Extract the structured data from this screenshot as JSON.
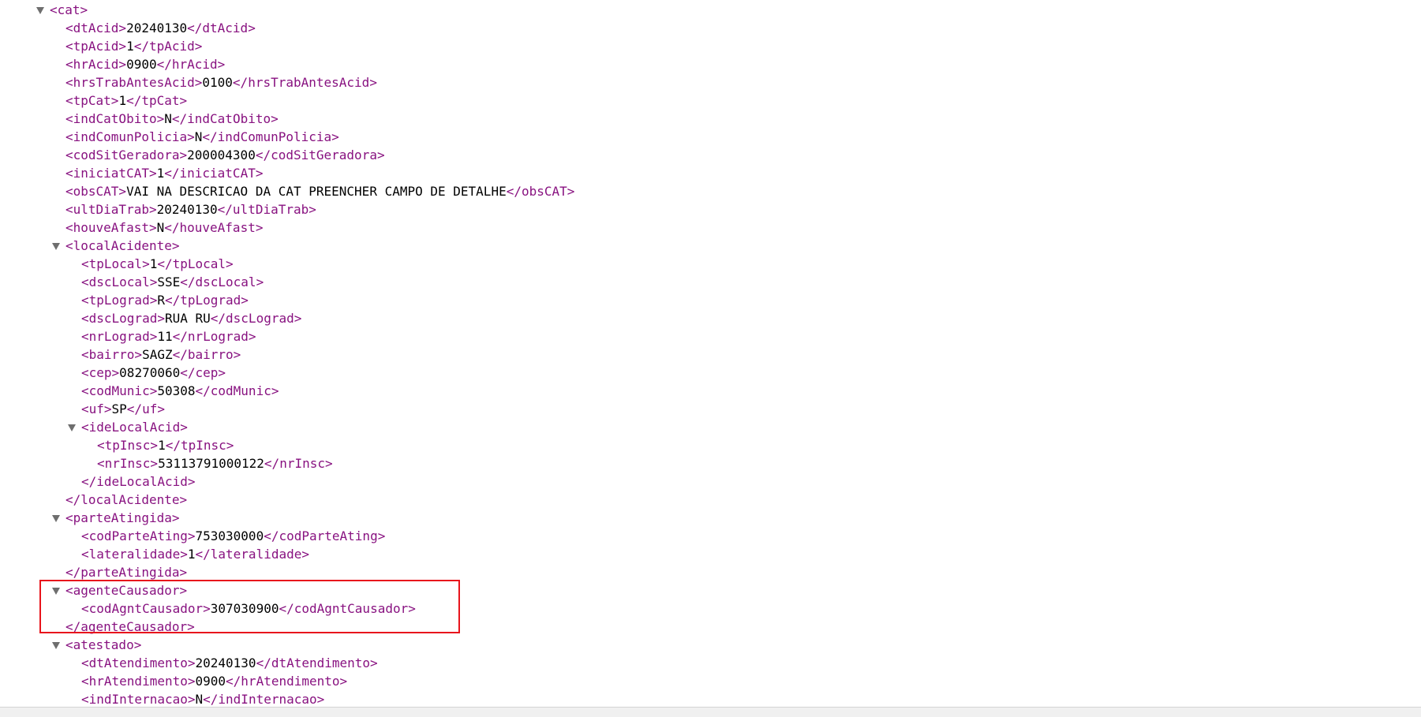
{
  "xml_lines": [
    {
      "depth": 0,
      "toggle": true,
      "open": "cat",
      "text": "",
      "close": ""
    },
    {
      "depth": 1,
      "toggle": false,
      "open": "dtAcid",
      "text": "20240130",
      "close": "dtAcid"
    },
    {
      "depth": 1,
      "toggle": false,
      "open": "tpAcid",
      "text": "1",
      "close": "tpAcid"
    },
    {
      "depth": 1,
      "toggle": false,
      "open": "hrAcid",
      "text": "0900",
      "close": "hrAcid"
    },
    {
      "depth": 1,
      "toggle": false,
      "open": "hrsTrabAntesAcid",
      "text": "0100",
      "close": "hrsTrabAntesAcid"
    },
    {
      "depth": 1,
      "toggle": false,
      "open": "tpCat",
      "text": "1",
      "close": "tpCat"
    },
    {
      "depth": 1,
      "toggle": false,
      "open": "indCatObito",
      "text": "N",
      "close": "indCatObito"
    },
    {
      "depth": 1,
      "toggle": false,
      "open": "indComunPolicia",
      "text": "N",
      "close": "indComunPolicia"
    },
    {
      "depth": 1,
      "toggle": false,
      "open": "codSitGeradora",
      "text": "200004300",
      "close": "codSitGeradora"
    },
    {
      "depth": 1,
      "toggle": false,
      "open": "iniciatCAT",
      "text": "1",
      "close": "iniciatCAT"
    },
    {
      "depth": 1,
      "toggle": false,
      "open": "obsCAT",
      "text": "VAI NA DESCRICAO DA CAT PREENCHER CAMPO DE DETALHE",
      "close": "obsCAT"
    },
    {
      "depth": 1,
      "toggle": false,
      "open": "ultDiaTrab",
      "text": "20240130",
      "close": "ultDiaTrab"
    },
    {
      "depth": 1,
      "toggle": false,
      "open": "houveAfast",
      "text": "N",
      "close": "houveAfast"
    },
    {
      "depth": 1,
      "toggle": true,
      "open": "localAcidente",
      "text": "",
      "close": ""
    },
    {
      "depth": 2,
      "toggle": false,
      "open": "tpLocal",
      "text": "1",
      "close": "tpLocal"
    },
    {
      "depth": 2,
      "toggle": false,
      "open": "dscLocal",
      "text": "SSE",
      "close": "dscLocal"
    },
    {
      "depth": 2,
      "toggle": false,
      "open": "tpLograd",
      "text": "R",
      "close": "tpLograd"
    },
    {
      "depth": 2,
      "toggle": false,
      "open": "dscLograd",
      "text": "RUA RU",
      "close": "dscLograd"
    },
    {
      "depth": 2,
      "toggle": false,
      "open": "nrLograd",
      "text": "11",
      "close": "nrLograd"
    },
    {
      "depth": 2,
      "toggle": false,
      "open": "bairro",
      "text": "SAGZ",
      "close": "bairro"
    },
    {
      "depth": 2,
      "toggle": false,
      "open": "cep",
      "text": "08270060",
      "close": "cep"
    },
    {
      "depth": 2,
      "toggle": false,
      "open": "codMunic",
      "text": "50308",
      "close": "codMunic"
    },
    {
      "depth": 2,
      "toggle": false,
      "open": "uf",
      "text": "SP",
      "close": "uf"
    },
    {
      "depth": 2,
      "toggle": true,
      "open": "ideLocalAcid",
      "text": "",
      "close": ""
    },
    {
      "depth": 3,
      "toggle": false,
      "open": "tpInsc",
      "text": "1",
      "close": "tpInsc"
    },
    {
      "depth": 3,
      "toggle": false,
      "open": "nrInsc",
      "text": "53113791000122",
      "close": "nrInsc"
    },
    {
      "depth": 2,
      "toggle": false,
      "open": "",
      "text": "",
      "close": "ideLocalAcid"
    },
    {
      "depth": 1,
      "toggle": false,
      "open": "",
      "text": "",
      "close": "localAcidente"
    },
    {
      "depth": 1,
      "toggle": true,
      "open": "parteAtingida",
      "text": "",
      "close": ""
    },
    {
      "depth": 2,
      "toggle": false,
      "open": "codParteAting",
      "text": "753030000",
      "close": "codParteAting"
    },
    {
      "depth": 2,
      "toggle": false,
      "open": "lateralidade",
      "text": "1",
      "close": "lateralidade"
    },
    {
      "depth": 1,
      "toggle": false,
      "open": "",
      "text": "",
      "close": "parteAtingida"
    },
    {
      "depth": 1,
      "toggle": true,
      "open": "agenteCausador",
      "text": "",
      "close": ""
    },
    {
      "depth": 2,
      "toggle": false,
      "open": "codAgntCausador",
      "text": "307030900",
      "close": "codAgntCausador"
    },
    {
      "depth": 1,
      "toggle": false,
      "open": "",
      "text": "",
      "close": "agenteCausador"
    },
    {
      "depth": 1,
      "toggle": true,
      "open": "atestado",
      "text": "",
      "close": ""
    },
    {
      "depth": 2,
      "toggle": false,
      "open": "dtAtendimento",
      "text": "20240130",
      "close": "dtAtendimento"
    },
    {
      "depth": 2,
      "toggle": false,
      "open": "hrAtendimento",
      "text": "0900",
      "close": "hrAtendimento"
    },
    {
      "depth": 2,
      "toggle": false,
      "open": "indInternacao",
      "text": "N",
      "close": "indInternacao"
    }
  ],
  "colors": {
    "tag": "#881280",
    "text": "#000000",
    "toggle": "#6e6e6e",
    "highlight_border": "#e8141c"
  },
  "icons": {
    "toggle": "collapse-triangle-icon"
  }
}
